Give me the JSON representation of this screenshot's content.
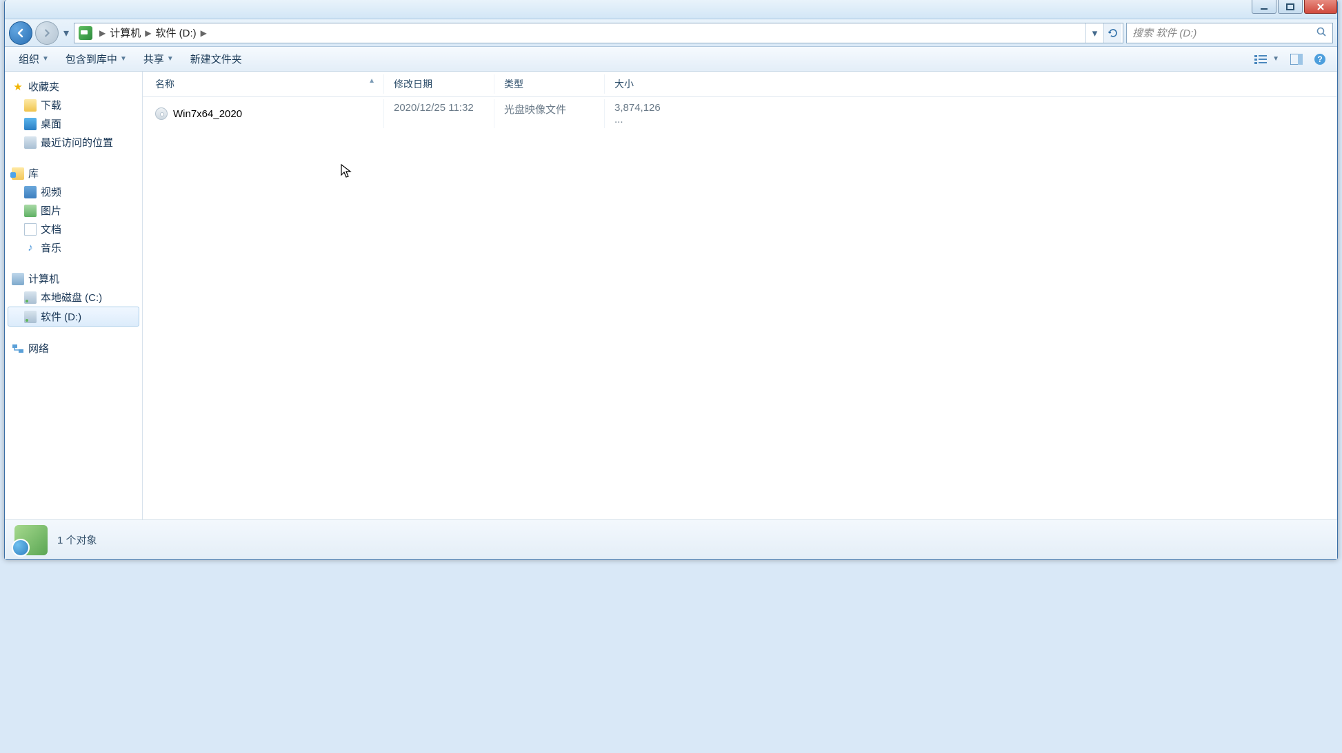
{
  "breadcrumb": {
    "computer": "计算机",
    "drive": "软件 (D:)"
  },
  "search": {
    "placeholder": "搜索 软件 (D:)"
  },
  "toolbar": {
    "organize": "组织",
    "include_in_lib": "包含到库中",
    "share": "共享",
    "new_folder": "新建文件夹"
  },
  "sidebar": {
    "favorites": "收藏夹",
    "downloads": "下载",
    "desktop": "桌面",
    "recent": "最近访问的位置",
    "libraries": "库",
    "videos": "视频",
    "pictures": "图片",
    "documents": "文档",
    "music": "音乐",
    "computer": "计算机",
    "drive_c": "本地磁盘 (C:)",
    "drive_d": "软件 (D:)",
    "network": "网络"
  },
  "columns": {
    "name": "名称",
    "date": "修改日期",
    "type": "类型",
    "size": "大小"
  },
  "files": [
    {
      "name": "Win7x64_2020",
      "date": "2020/12/25 11:32",
      "type": "光盘映像文件",
      "size": "3,874,126 ..."
    }
  ],
  "status": {
    "count": "1 个对象"
  }
}
